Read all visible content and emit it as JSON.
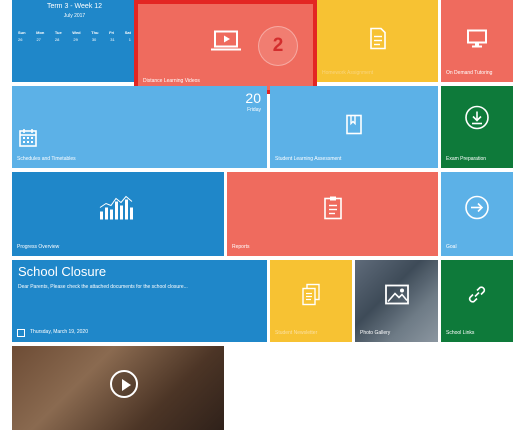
{
  "calendar": {
    "title": "Term 3 - Week 12",
    "subtitle": "July 2017",
    "days": [
      "Sun",
      "Mon",
      "Tue",
      "Wed",
      "Thu",
      "Fri",
      "Sat"
    ],
    "dates": [
      "26",
      "27",
      "28",
      "29",
      "30",
      "31",
      "1"
    ]
  },
  "tiles": {
    "distance_learning": "Distance Learning Videos",
    "homework": "Homework Assignment",
    "on_demand": "On Demand Tutoring",
    "schedules": "Schedules and Timetables",
    "day_number": "20",
    "day_name": "Friday",
    "student_learning": "Student Learning Assessment",
    "exam_prep": "Exam Preparation",
    "progress": "Progress Overview",
    "reports": "Reports",
    "goal": "Goal",
    "school_closure_title": "School Closure",
    "school_closure_body": "Dear Parents, Please check the attached documents for the school closure...",
    "school_closure_date": "Thursday, March 19, 2020",
    "student_newsletter": "Student Newsletter",
    "photo_gallery": "Photo Gallery",
    "school_links": "School Links"
  },
  "annotation": {
    "step_number": "2"
  },
  "colors": {
    "blue": "#1f87c9",
    "light_blue": "#5cb1e7",
    "red": "#ef6b5e",
    "yellow": "#f7c233",
    "green": "#0e7a3a",
    "highlight": "#e32623"
  }
}
